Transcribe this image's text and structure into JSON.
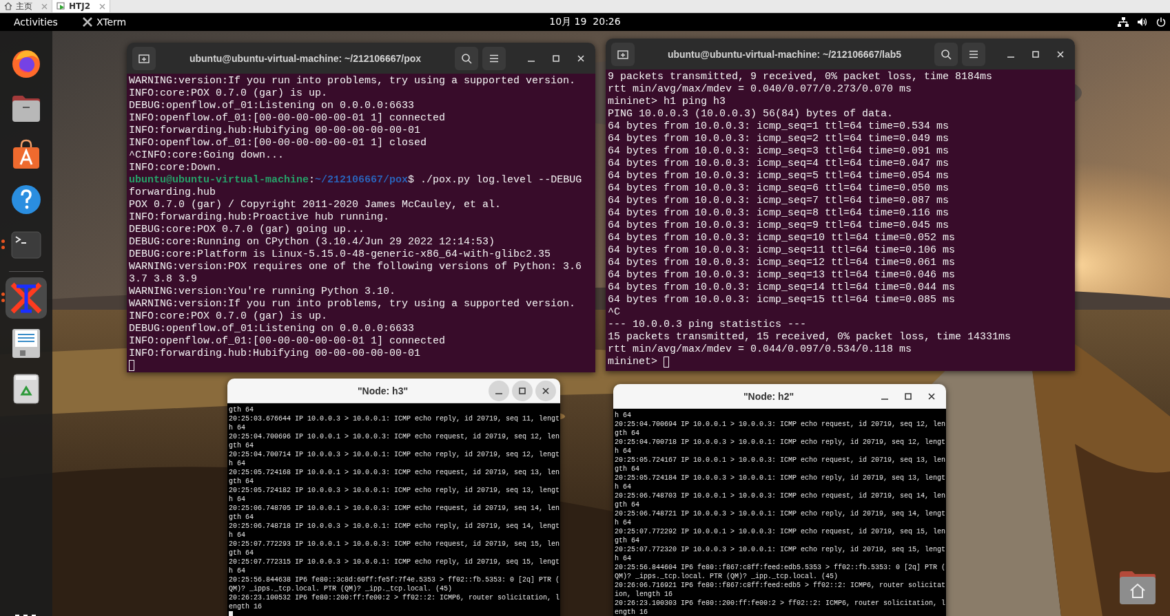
{
  "vm_tabs": [
    {
      "label": "主页",
      "selected": false
    },
    {
      "label": "HTJ2",
      "selected": true
    }
  ],
  "top_bar": {
    "activities": "Activities",
    "app": "XTerm",
    "clock": "10月 19  20:26"
  },
  "dock": [
    {
      "kind": "firefox",
      "running": false,
      "selected": false
    },
    {
      "kind": "files",
      "running": false,
      "selected": false
    },
    {
      "kind": "software",
      "running": false,
      "selected": false
    },
    {
      "kind": "help",
      "running": false,
      "selected": false
    },
    {
      "kind": "terminal",
      "running": true,
      "selected": false
    },
    {
      "kind": "xterm",
      "running": true,
      "selected": true
    },
    {
      "kind": "editor",
      "running": false,
      "selected": false
    },
    {
      "kind": "trash",
      "running": false,
      "selected": false
    }
  ],
  "windows": [
    {
      "kind": "terminal",
      "title": "ubuntu@ubuntu-virtual-machine: ~/212106667/pox",
      "focused": false,
      "cursor": true,
      "cursor_new_line": true,
      "lines": [
        "WARNING:version:If you run into problems, try using a supported version.",
        "INFO:core:POX 0.7.0 (gar) is up.",
        "DEBUG:openflow.of_01:Listening on 0.0.0.0:6633",
        "INFO:openflow.of_01:[00-00-00-00-00-01 1] connected",
        "INFO:forwarding.hub:Hubifying 00-00-00-00-00-01",
        "INFO:openflow.of_01:[00-00-00-00-00-01 1] closed",
        "^CINFO:core:Going down...",
        "INFO:core:Down.",
        {
          "kind": "prompt",
          "user": "ubuntu@ubuntu-virtual-machine",
          "separator": ":",
          "path": "~/212106667/pox",
          "command": "$ ./pox.py log.level --DEBUG"
        },
        "forwarding.hub",
        "POX 0.7.0 (gar) / Copyright 2011-2020 James McCauley, et al.",
        "INFO:forwarding.hub:Proactive hub running.",
        "DEBUG:core:POX 0.7.0 (gar) going up...",
        "DEBUG:core:Running on CPython (3.10.4/Jun 29 2022 12:14:53)",
        "DEBUG:core:Platform is Linux-5.15.0-48-generic-x86_64-with-glibc2.35",
        "WARNING:version:POX requires one of the following versions of Python: 3.6",
        "3.7 3.8 3.9",
        "WARNING:version:You're running Python 3.10.",
        "WARNING:version:If you run into problems, try using a supported version.",
        "INFO:core:POX 0.7.0 (gar) is up.",
        "DEBUG:openflow.of_01:Listening on 0.0.0.0:6633",
        "INFO:openflow.of_01:[00-00-00-00-00-01 1] connected",
        "INFO:forwarding.hub:Hubifying 00-00-00-00-00-01"
      ]
    },
    {
      "kind": "terminal",
      "title": "ubuntu@ubuntu-virtual-machine: ~/212106667/lab5",
      "focused": false,
      "cursor": true,
      "cursor_new_line": false,
      "lines": [
        "9 packets transmitted, 9 received, 0% packet loss, time 8184ms",
        "rtt min/avg/max/mdev = 0.040/0.077/0.273/0.070 ms",
        "mininet> h1 ping h3",
        "PING 10.0.0.3 (10.0.0.3) 56(84) bytes of data.",
        "64 bytes from 10.0.0.3: icmp_seq=1 ttl=64 time=0.534 ms",
        "64 bytes from 10.0.0.3: icmp_seq=2 ttl=64 time=0.049 ms",
        "64 bytes from 10.0.0.3: icmp_seq=3 ttl=64 time=0.091 ms",
        "64 bytes from 10.0.0.3: icmp_seq=4 ttl=64 time=0.047 ms",
        "64 bytes from 10.0.0.3: icmp_seq=5 ttl=64 time=0.054 ms",
        "64 bytes from 10.0.0.3: icmp_seq=6 ttl=64 time=0.050 ms",
        "64 bytes from 10.0.0.3: icmp_seq=7 ttl=64 time=0.087 ms",
        "64 bytes from 10.0.0.3: icmp_seq=8 ttl=64 time=0.116 ms",
        "64 bytes from 10.0.0.3: icmp_seq=9 ttl=64 time=0.045 ms",
        "64 bytes from 10.0.0.3: icmp_seq=10 ttl=64 time=0.052 ms",
        "64 bytes from 10.0.0.3: icmp_seq=11 ttl=64 time=0.106 ms",
        "64 bytes from 10.0.0.3: icmp_seq=12 ttl=64 time=0.061 ms",
        "64 bytes from 10.0.0.3: icmp_seq=13 ttl=64 time=0.046 ms",
        "64 bytes from 10.0.0.3: icmp_seq=14 ttl=64 time=0.044 ms",
        "64 bytes from 10.0.0.3: icmp_seq=15 ttl=64 time=0.085 ms",
        "^C",
        "--- 10.0.0.3 ping statistics ---",
        "15 packets transmitted, 15 received, 0% packet loss, time 14331ms",
        "rtt min/avg/max/mdev = 0.044/0.097/0.534/0.118 ms",
        "mininet>"
      ]
    },
    {
      "kind": "xterm",
      "title": "\"Node: h3\"",
      "focused": true,
      "cursor": true,
      "cursor_new_line": true,
      "lines": [
        "gth 64",
        "20:25:03.676644 IP 10.0.0.3 > 10.0.0.1: ICMP echo reply, id 20719, seq 11, lengt",
        "h 64",
        "20:25:04.700696 IP 10.0.0.1 > 10.0.0.3: ICMP echo request, id 20719, seq 12, len",
        "gth 64",
        "20:25:04.700714 IP 10.0.0.3 > 10.0.0.1: ICMP echo reply, id 20719, seq 12, lengt",
        "h 64",
        "20:25:05.724168 IP 10.0.0.1 > 10.0.0.3: ICMP echo request, id 20719, seq 13, len",
        "gth 64",
        "20:25:05.724182 IP 10.0.0.3 > 10.0.0.1: ICMP echo reply, id 20719, seq 13, lengt",
        "h 64",
        "20:25:06.748705 IP 10.0.0.1 > 10.0.0.3: ICMP echo request, id 20719, seq 14, len",
        "gth 64",
        "20:25:06.748718 IP 10.0.0.3 > 10.0.0.1: ICMP echo reply, id 20719, seq 14, lengt",
        "h 64",
        "20:25:07.772293 IP 10.0.0.1 > 10.0.0.3: ICMP echo request, id 20719, seq 15, len",
        "gth 64",
        "20:25:07.772315 IP 10.0.0.3 > 10.0.0.1: ICMP echo reply, id 20719, seq 15, lengt",
        "h 64",
        "20:25:56.844638 IP6 fe80::3c8d:60ff:fe5f:7f4e.5353 > ff02::fb.5353: 0 [2q] PTR (",
        "QM)? _ipps._tcp.local. PTR (QM)? _ipp._tcp.local. (45)",
        "20:26:23.100532 IP6 fe80::200:ff:fe00:2 > ff02::2: ICMP6, router solicitation, l",
        "ength 16"
      ]
    },
    {
      "kind": "xterm",
      "title": "\"Node: h2\"",
      "focused": false,
      "lines": [
        "h 64",
        "20:25:04.700694 IP 10.0.0.1 > 10.0.0.3: ICMP echo request, id 20719, seq 12, len",
        "gth 64",
        "20:25:04.700718 IP 10.0.0.3 > 10.0.0.1: ICMP echo reply, id 20719, seq 12, lengt",
        "h 64",
        "20:25:05.724167 IP 10.0.0.1 > 10.0.0.3: ICMP echo request, id 20719, seq 13, len",
        "gth 64",
        "20:25:05.724184 IP 10.0.0.3 > 10.0.0.1: ICMP echo reply, id 20719, seq 13, lengt",
        "h 64",
        "20:25:06.748703 IP 10.0.0.1 > 10.0.0.3: ICMP echo request, id 20719, seq 14, len",
        "gth 64",
        "20:25:06.748721 IP 10.0.0.3 > 10.0.0.1: ICMP echo reply, id 20719, seq 14, lengt",
        "h 64",
        "20:25:07.772292 IP 10.0.0.1 > 10.0.0.3: ICMP echo request, id 20719, seq 15, len",
        "gth 64",
        "20:25:07.772320 IP 10.0.0.3 > 10.0.0.1: ICMP echo reply, id 20719, seq 15, lengt",
        "h 64",
        "20:25:56.844604 IP6 fe80::f867:c8ff:feed:edb5.5353 > ff02::fb.5353: 0 [2q] PTR (",
        "QM)? _ipps._tcp.local. PTR (QM)? _ipp._tcp.local. (45)",
        "20:26:06.716921 IP6 fe80::f867:c8ff:feed:edb5 > ff02::2: ICMP6, router solicitat",
        "ion, length 16",
        "20:26:23.100303 IP6 fe80::200:ff:fe00:2 > ff02::2: ICMP6, router solicitation, l",
        "ength 16"
      ]
    }
  ]
}
